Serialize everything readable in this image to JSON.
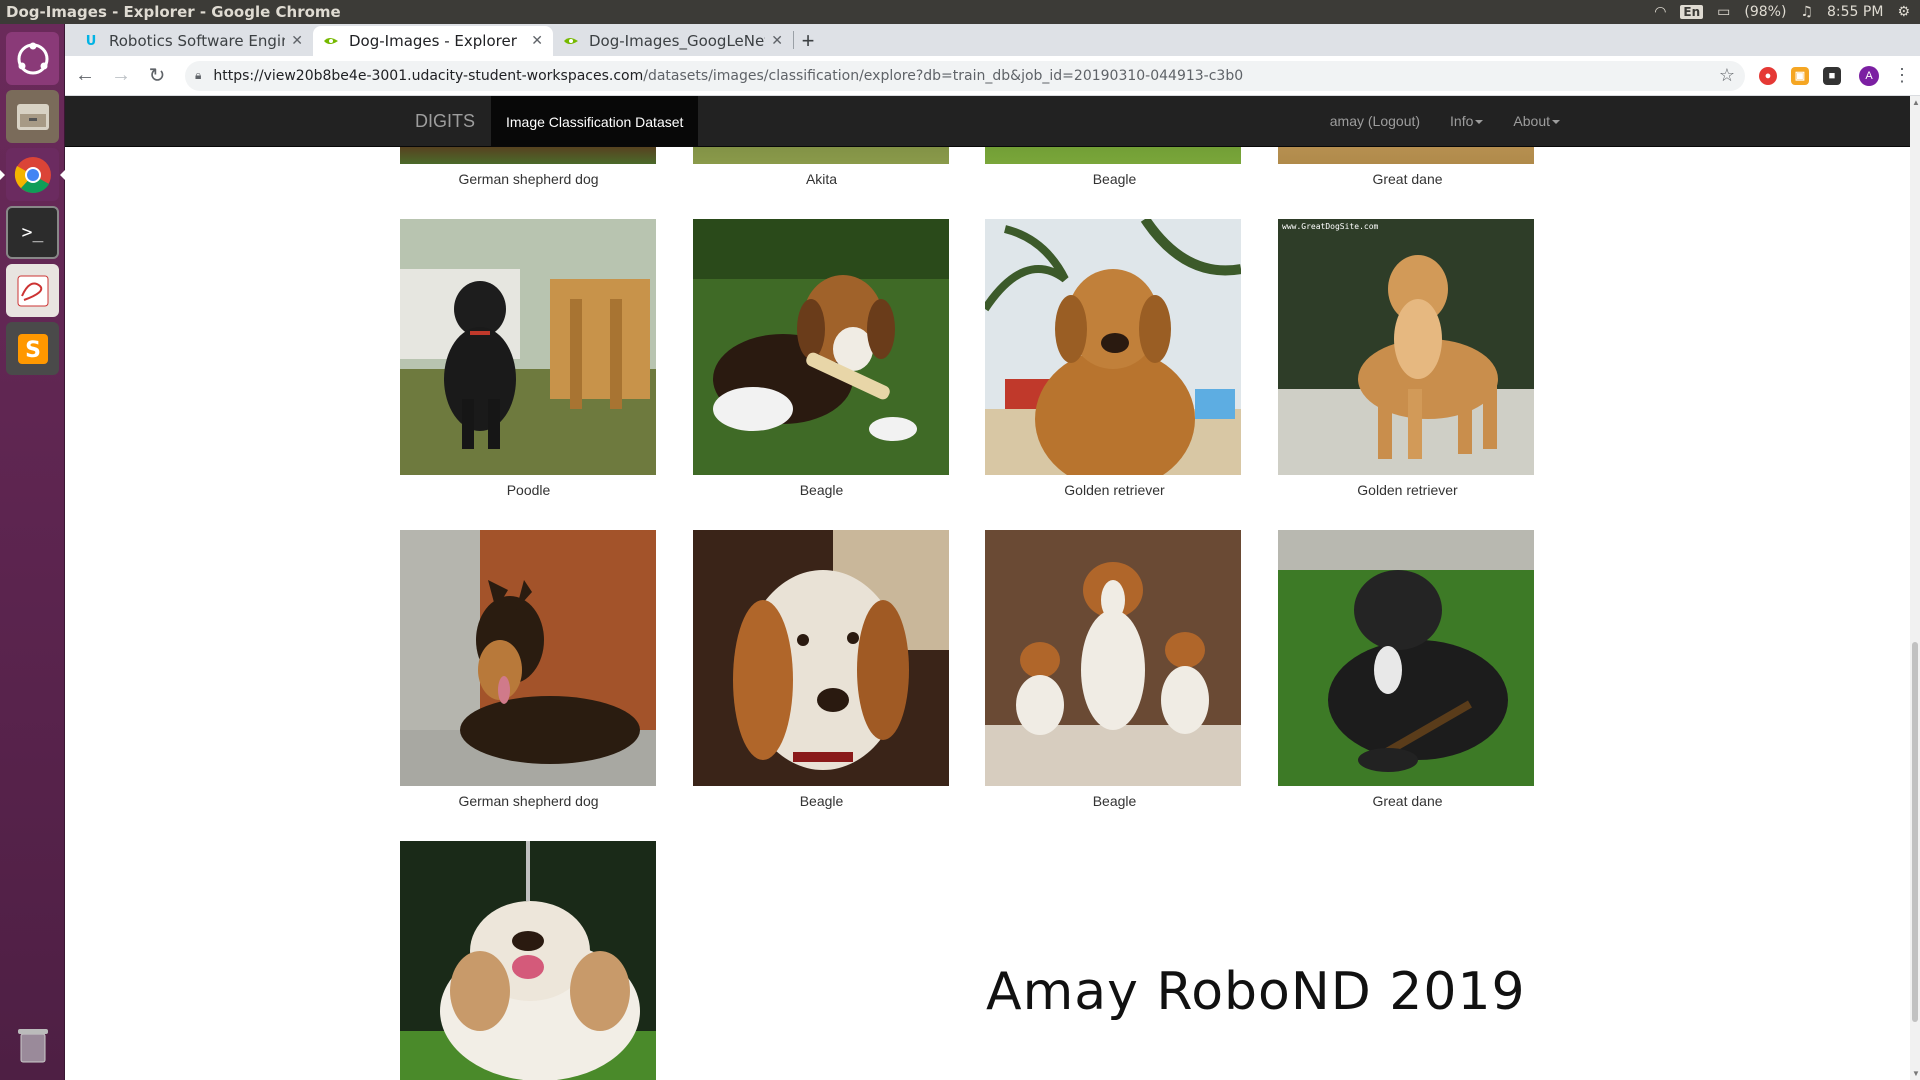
{
  "os": {
    "window_title": "Dog-Images - Explorer - Google Chrome",
    "language": "En",
    "battery": "(98%)",
    "clock": "8:55 PM"
  },
  "tabs": [
    {
      "label": "Robotics Software Engine",
      "favicon": "udacity-icon",
      "active": false
    },
    {
      "label": "Dog-Images - Explorer",
      "favicon": "nvidia-icon",
      "active": true
    },
    {
      "label": "Dog-Images_GoogLeNet",
      "favicon": "nvidia-icon",
      "active": false
    }
  ],
  "address_bar": {
    "host": "https://view20b8be4e-3001.udacity-student-workspaces.com",
    "path": "/datasets/images/classification/explore?db=train_db&job_id=20190310-044913-c3b0"
  },
  "navbar": {
    "brand": "DIGITS",
    "active_item": "Image Classification Dataset",
    "user": "amay (Logout)",
    "info": "Info",
    "about": "About"
  },
  "top_row_captions": [
    "German shepherd dog",
    "Akita",
    "Beagle",
    "Great dane"
  ],
  "rows": [
    [
      "Poodle",
      "Beagle",
      "Golden retriever",
      "Golden retriever"
    ],
    [
      "German shepherd dog",
      "Beagle",
      "Beagle",
      "Great dane"
    ]
  ],
  "watermark_text": "www.GreatDogSite.com",
  "signature": "Amay RoboND 2019",
  "colors": {
    "navbar_bg": "#222222",
    "launcher_bg": "#5e2750",
    "chrome_tabstrip": "#dee1e6"
  }
}
